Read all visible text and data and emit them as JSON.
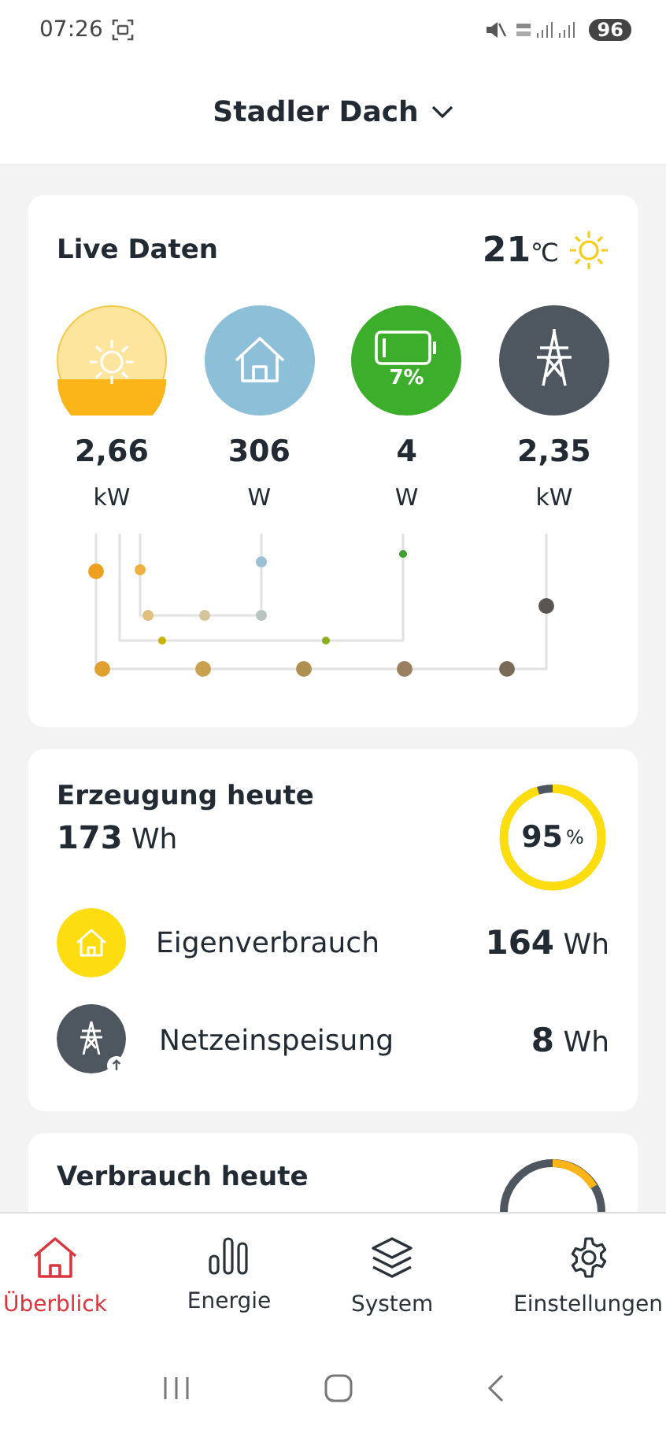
{
  "status_bar": {
    "time": "07:26",
    "battery": "96"
  },
  "header": {
    "title": "Stadler Dach"
  },
  "live": {
    "title": "Live Daten",
    "temperature": "21",
    "temperature_unit": "℃",
    "tiles": [
      {
        "kind": "sun",
        "value": "2,66",
        "unit": "kW"
      },
      {
        "kind": "house",
        "value": "306",
        "unit": "W"
      },
      {
        "kind": "battery",
        "badge": "7%",
        "value": "4",
        "unit": "W"
      },
      {
        "kind": "grid",
        "value": "2,35",
        "unit": "kW"
      }
    ]
  },
  "production": {
    "title": "Erzeugung heute",
    "value": "173",
    "unit": "Wh",
    "ratio": "95",
    "ratio_unit": "%",
    "level": 0.95,
    "rows": [
      {
        "kind": "house",
        "label": "Eigenverbrauch",
        "value": "164",
        "unit": "Wh"
      },
      {
        "kind": "grid",
        "label": "Netzeinspeisung",
        "value": "8",
        "unit": "Wh"
      }
    ]
  },
  "consumption": {
    "title": "Verbrauch heute"
  },
  "tabs": [
    {
      "kind": "home",
      "label": "Überblick",
      "selected": true
    },
    {
      "kind": "bars",
      "label": "Energie",
      "selected": false
    },
    {
      "kind": "layers",
      "label": "System",
      "selected": false
    },
    {
      "kind": "gear",
      "label": "Einstellungen",
      "selected": false
    }
  ]
}
